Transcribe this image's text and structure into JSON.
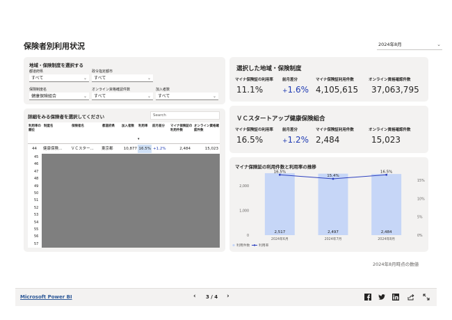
{
  "page": {
    "title": "保険者別利用状況",
    "date_filter": "2024年8月",
    "note": "2024年8月時点の数値"
  },
  "filters": {
    "title": "地域・保険制度を選択する",
    "prefecture": {
      "label": "都道府県",
      "value": "すべて"
    },
    "city": {
      "label": "政令指定都市",
      "value": "すべて"
    },
    "insurance_type": {
      "label": "保険制度名",
      "value": "健康保険組合"
    },
    "online_count": {
      "label": "オンライン資格確認件数",
      "value": "すべて"
    },
    "members": {
      "label": "加入者数",
      "value": "すべて"
    }
  },
  "table": {
    "title": "詳細をみる保険者を選択してください",
    "search_placeholder": "Search",
    "headers": [
      "利用率の順位",
      "制度名",
      "保険者名",
      "都道府県",
      "加入者数",
      "利用率",
      "前月差分",
      "マイナ保険証の利用件数",
      "オンライン資格確認件数"
    ],
    "row": [
      "44",
      "健康保険...",
      "ＶＣスター...",
      "東京都",
      "10,877",
      "16.5%",
      "+1.2%",
      "2,484",
      "15,023"
    ],
    "row_numbers": [
      "45",
      "46",
      "47",
      "48",
      "49",
      "50",
      "51",
      "52",
      "53",
      "54",
      "55",
      "56",
      "57"
    ]
  },
  "kpi_region": {
    "title": "選択した地域・保険制度",
    "labels": [
      "マイナ保険証の利用率",
      "前月差分",
      "マイナ保険証利用件数",
      "オンライン資格確認件数"
    ],
    "rate": "11.1%",
    "diff_sign": "+",
    "diff": "1.6%",
    "uses": "4,105,615",
    "online": "37,063,795"
  },
  "kpi_insurer": {
    "title": "ＶＣスタートアップ健康保険組合",
    "labels": [
      "マイナ保険証の利用率",
      "前月差分",
      "マイナ保険証利用件数",
      "オンライン資格確認件数"
    ],
    "rate": "16.5%",
    "diff_sign": "+",
    "diff": "1.2%",
    "uses": "2,484",
    "online": "15,023"
  },
  "chart_data": {
    "type": "bar",
    "title": "マイナ保険証の利用件数と利用率の推移",
    "categories": [
      "2024年6月",
      "2024年7月",
      "2024年8月"
    ],
    "series": [
      {
        "name": "利用件数",
        "values": [
          2517,
          2497,
          2484
        ],
        "labels": [
          "2,517",
          "2,497",
          "2,484"
        ],
        "axis": "left",
        "kind": "bar",
        "color": "#c6d6f7"
      },
      {
        "name": "利用率",
        "values": [
          16.5,
          15.4,
          16.5
        ],
        "labels": [
          "16.5%",
          "15.4%",
          "16.5%"
        ],
        "axis": "right",
        "kind": "line",
        "color": "#2b3fbf"
      }
    ],
    "y_left": {
      "min": 0,
      "max": 2600,
      "ticks": [
        0,
        1000,
        2000
      ],
      "tick_labels": [
        "0",
        "1,000",
        "2,000"
      ]
    },
    "y_right": {
      "min": 0,
      "max": 17.5,
      "ticks": [
        0,
        5,
        10,
        15
      ],
      "tick_labels": [
        "0%",
        "5%",
        "10%",
        "15%"
      ]
    },
    "legend": "bottom-left"
  },
  "footer": {
    "brand": "Microsoft Power BI",
    "page_indicator": "3 / 4"
  },
  "colors": {
    "accent_blue": "#1f3bb3",
    "bar": "#c6d6f7",
    "line": "#2b3fbf",
    "card_bg": "#f3f2f1"
  }
}
